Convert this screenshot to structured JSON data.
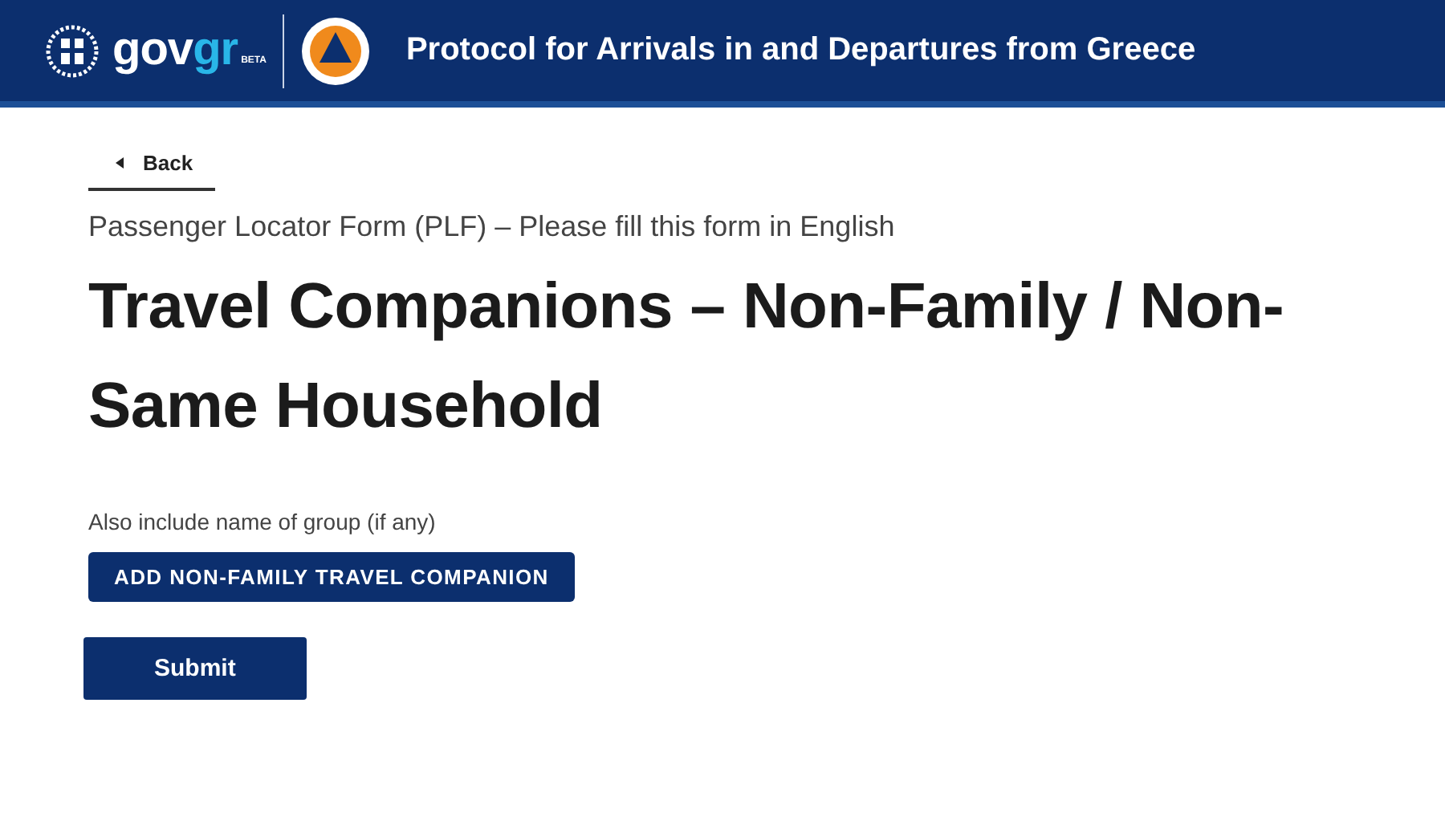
{
  "header": {
    "logo": {
      "prefix": "gov",
      "suffix": "gr",
      "badge": "BETA"
    },
    "title": "Protocol for Arrivals in and Departures from Greece"
  },
  "back_link": {
    "label": "Back"
  },
  "form_name": "Passenger Locator Form (PLF) – Please fill this form in English",
  "heading": "Travel Companions – Non-Family / Non-Same Household",
  "hint": "Also include name of group (if any)",
  "add_button": {
    "label": "ADD NON-FAMILY TRAVEL COMPANION"
  },
  "submit_button": {
    "label": "Submit"
  }
}
